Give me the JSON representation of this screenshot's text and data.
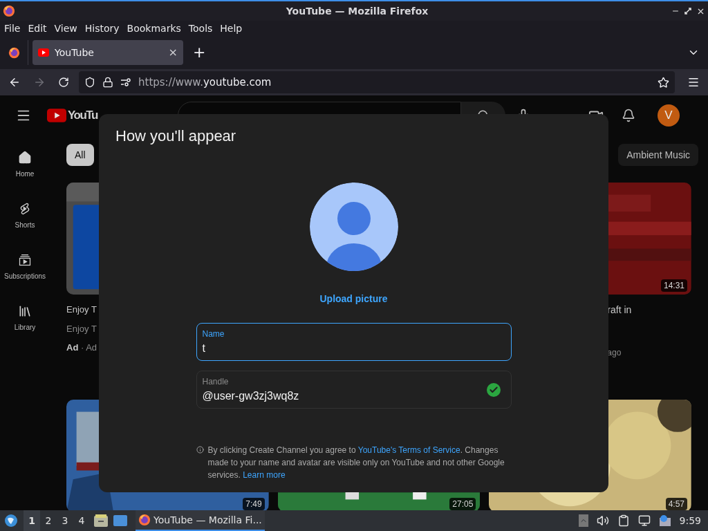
{
  "window": {
    "title": "YouTube — Mozilla Firefox"
  },
  "menu": [
    "File",
    "Edit",
    "View",
    "History",
    "Bookmarks",
    "Tools",
    "Help"
  ],
  "tabs": [
    {
      "label": "YouTube",
      "selected": true,
      "close": "×"
    }
  ],
  "new_tab": "+",
  "nav": {
    "back_disabled": false,
    "forward_disabled": true,
    "url_prefix": "https://www.",
    "url_host": "youtube.com"
  },
  "youtube": {
    "logo_text": "YouTu",
    "avatar_letter": "V",
    "sidebar": [
      {
        "kind": "home",
        "label": "Home"
      },
      {
        "kind": "shorts",
        "label": "Shorts"
      },
      {
        "kind": "subscriptions",
        "label": "Subscriptions"
      },
      {
        "kind": "library",
        "label": "Library"
      }
    ],
    "chips": [
      {
        "label": "All",
        "selected": true
      },
      {
        "label": "Ambient Music",
        "selected": false
      }
    ],
    "left_card": {
      "title": "Enjoy T",
      "channel": "Enjoy T",
      "ad": "Ad",
      "sep": " · ",
      "ad_rest": "Ad"
    },
    "right_card": {
      "duration": "14:31",
      "title": "raft in",
      "meta": "ago"
    },
    "bottom_durations": [
      "7:49",
      "27:05",
      "4:57"
    ]
  },
  "dialog": {
    "title": "How you'll appear",
    "upload": "Upload picture",
    "fields": [
      {
        "label": "Name",
        "value": "t",
        "focused": true,
        "valid": false
      },
      {
        "label": "Handle",
        "value": "@user-gw3zj3wq8z",
        "focused": false,
        "valid": true
      }
    ],
    "notice": "By clicking Create Channel you agree to ",
    "terms_link": "YouTube's Terms of Service",
    "notice_2": ". Changes made to your name and avatar are visible only on YouTube and not other Google services. ",
    "learn_link": "Learn more"
  },
  "taskbar": {
    "workspaces": [
      {
        "label": "1",
        "selected": true
      },
      {
        "label": "2",
        "selected": false
      },
      {
        "label": "3",
        "selected": false
      },
      {
        "label": "4",
        "selected": false
      }
    ],
    "tasks": [
      {
        "label": "YouTube — Mozilla Fi...",
        "selected": true
      }
    ],
    "clock": "9:59"
  }
}
